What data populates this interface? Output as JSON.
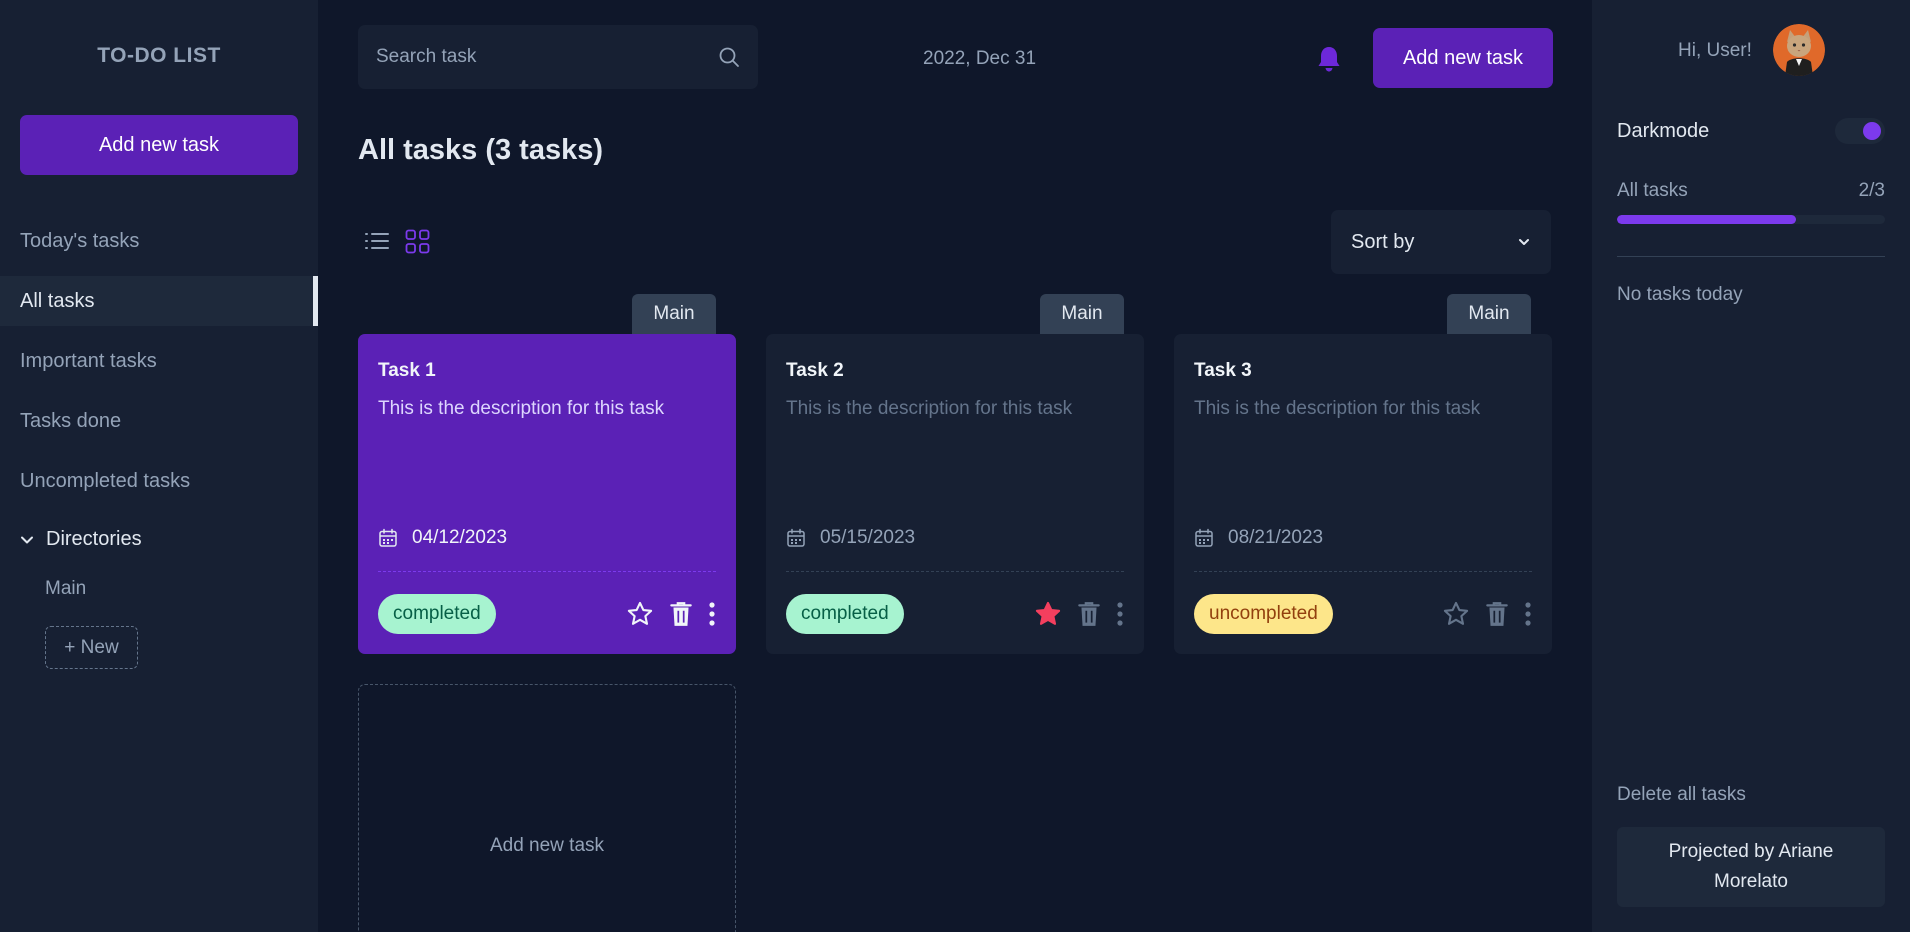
{
  "sidebar": {
    "brand": "TO-DO LIST",
    "add_button": "Add new task",
    "nav": [
      {
        "label": "Today's tasks",
        "active": false
      },
      {
        "label": "All tasks",
        "active": true
      },
      {
        "label": "Important tasks",
        "active": false
      },
      {
        "label": "Tasks done",
        "active": false
      },
      {
        "label": "Uncompleted tasks",
        "active": false
      }
    ],
    "directories_label": "Directories",
    "directories": [
      "Main"
    ],
    "new_directory": "+ New"
  },
  "header": {
    "search_placeholder": "Search task",
    "date": "2022, Dec 31",
    "add_button": "Add new task"
  },
  "main": {
    "title": "All tasks (3 tasks)",
    "sort_label": "Sort by",
    "add_card_label": "Add new task",
    "tasks": [
      {
        "tag": "Main",
        "title": "Task 1",
        "description": "This is the description for this task",
        "date": "04/12/2023",
        "status": "completed",
        "important": false
      },
      {
        "tag": "Main",
        "title": "Task 2",
        "description": "This is the description for this task",
        "date": "05/15/2023",
        "status": "completed",
        "important": true
      },
      {
        "tag": "Main",
        "title": "Task 3",
        "description": "This is the description for this task",
        "date": "08/21/2023",
        "status": "uncompleted",
        "important": false
      }
    ]
  },
  "right_panel": {
    "greeting": "Hi, User!",
    "darkmode_label": "Darkmode",
    "darkmode_on": true,
    "progress_label": "All tasks",
    "progress_text": "2/3",
    "progress_fraction": 0.667,
    "no_tasks": "No tasks today",
    "delete_all": "Delete all tasks",
    "credit": "Projected by Ariane Morelato"
  },
  "colors": {
    "accent": "#5b21b6",
    "accent_light": "#7c3aed",
    "star_active": "#f43f5e",
    "completed_bg": "#a7f3d0",
    "uncompleted_bg": "#fde68a"
  },
  "icons": [
    "search-icon",
    "bell-icon",
    "list-view-icon",
    "grid-view-icon",
    "chevron-down-icon",
    "calendar-icon",
    "star-icon",
    "trash-icon",
    "more-vertical-icon"
  ]
}
